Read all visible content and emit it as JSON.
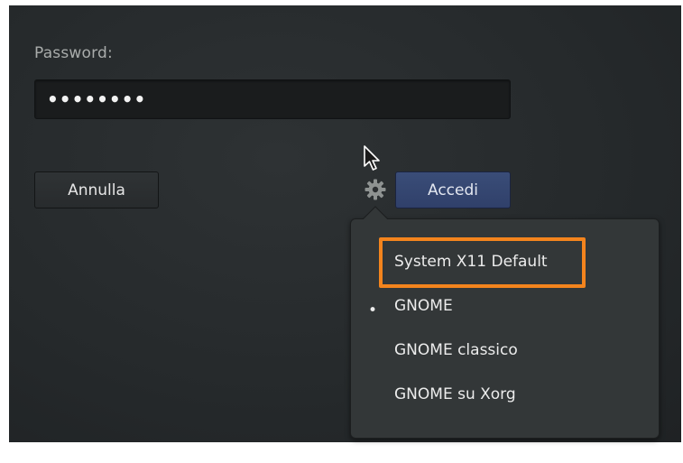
{
  "login": {
    "password_label": "Password:",
    "password_value": "••••••••",
    "cancel_label": "Annulla",
    "login_label": "Accedi"
  },
  "session_menu": {
    "items": [
      {
        "label": "System X11 Default",
        "selected": false,
        "highlighted": true
      },
      {
        "label": "GNOME",
        "selected": true,
        "highlighted": false
      },
      {
        "label": "GNOME classico",
        "selected": false,
        "highlighted": false
      },
      {
        "label": "GNOME su Xorg",
        "selected": false,
        "highlighted": false
      }
    ],
    "selected_marker": "•"
  },
  "icons": {
    "settings": "gear-icon",
    "pointer": "mouse-cursor-icon"
  },
  "colors": {
    "background": "#25292b",
    "login_button": "#30406a",
    "highlight_border": "#f4841d",
    "popover": "#333738"
  }
}
